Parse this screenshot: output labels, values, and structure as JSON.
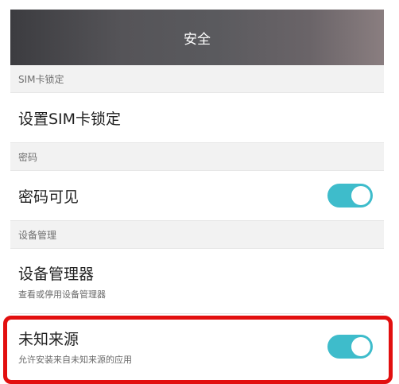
{
  "titlebar": {
    "title": "安全"
  },
  "sections": {
    "sim": {
      "header": "SIM卡锁定",
      "item_label": "设置SIM卡锁定"
    },
    "password": {
      "header": "密码",
      "item_label": "密码可见",
      "toggle_on": true
    },
    "device_admin": {
      "header": "设备管理",
      "item_label": "设备管理器",
      "item_sub": "查看或停用设备管理器"
    },
    "unknown_sources": {
      "item_label": "未知来源",
      "item_sub": "允许安装来自未知来源的应用",
      "toggle_on": true
    }
  },
  "colors": {
    "toggle_on": "#3ebccb",
    "highlight": "#e20f0f",
    "section_bg": "#f2f2f2"
  }
}
